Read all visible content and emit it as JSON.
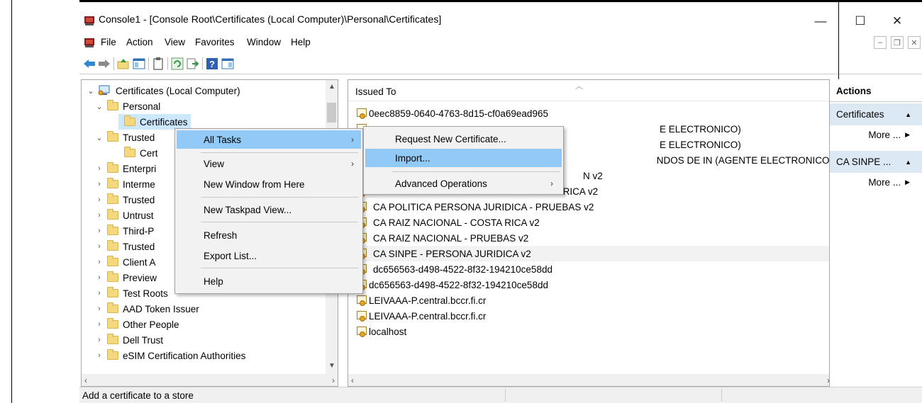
{
  "window": {
    "title": "Console1 - [Console Root\\Certificates (Local Computer)\\Personal\\Certificates]",
    "minimize_glyph": "—",
    "maximize_glyph": "☐",
    "close_glyph": "✕"
  },
  "menubar": {
    "items": [
      "File",
      "Action",
      "View",
      "Favorites",
      "Window",
      "Help"
    ]
  },
  "toolbar": {
    "icons": [
      "back-arrow-icon",
      "forward-arrow-icon",
      "up-folder-icon",
      "show-hide-console-tree-icon",
      "properties-icon",
      "refresh-icon",
      "export-list-icon",
      "help-icon",
      "show-hide-action-pane-icon"
    ]
  },
  "tree": {
    "items": [
      {
        "label": "Certificates (Local Computer)",
        "expanded": true,
        "icon": "computer-cert-icon"
      },
      {
        "label": "Personal",
        "expanded": true
      },
      {
        "label": "Certificates",
        "selected": true
      },
      {
        "label": "Trusted",
        "expanded": true
      },
      {
        "label": "Cert"
      },
      {
        "label": "Enterpri"
      },
      {
        "label": "Interme"
      },
      {
        "label": "Trusted"
      },
      {
        "label": "Untrust"
      },
      {
        "label": "Third-P"
      },
      {
        "label": "Trusted"
      },
      {
        "label": "Client A"
      },
      {
        "label": "Preview"
      },
      {
        "label": "Test Roots"
      },
      {
        "label": "AAD Token Issuer"
      },
      {
        "label": "Other People"
      },
      {
        "label": "Dell Trust"
      },
      {
        "label": "eSIM Certification Authorities"
      }
    ]
  },
  "list": {
    "column_header": "Issued To",
    "rows": [
      "0eec8859-0640-4763-8d15-cf0a69ead965",
      "E ELECTRONICO)",
      "E ELECTRONICO)",
      "NDOS DE IN (AGENTE ELECTRONICO)",
      "N v2",
      "A POLITICA PERSONA JURIDICA - COSTA RICA v2",
      "CA POLITICA PERSONA JURIDICA - PRUEBAS v2",
      "CA RAIZ NACIONAL - COSTA RICA v2",
      "CA RAIZ NACIONAL - PRUEBAS v2",
      "CA SINPE - PERSONA JURIDICA v2",
      "dc656563-d498-4522-8f32-194210ce58dd",
      "dc656563-d498-4522-8f32-194210ce58dd",
      "LEIVAAA-P.central.bccr.fi.cr",
      "LEIVAAA-P.central.bccr.fi.cr",
      "localhost"
    ],
    "partial_row_2": "BANCO CENTRAL DE COSTA RICA (AGENTE ELECTRONICO)"
  },
  "actions": {
    "header": "Actions",
    "groups": [
      {
        "title": "Certificates",
        "more": "More ..."
      },
      {
        "title": "CA SINPE ...",
        "more": "More ..."
      }
    ]
  },
  "context_menu": {
    "items": [
      {
        "label": "All Tasks",
        "submenu": true,
        "highlighted": true
      },
      {
        "label": "View",
        "submenu": true
      },
      {
        "label": "New Window from Here"
      },
      {
        "label": "New Taskpad View..."
      },
      {
        "label": "Refresh"
      },
      {
        "label": "Export List..."
      },
      {
        "label": "Help"
      }
    ]
  },
  "submenu": {
    "items": [
      {
        "label": "Request New Certificate..."
      },
      {
        "label": "Import...",
        "highlighted": true
      },
      {
        "label": "Advanced Operations",
        "submenu": true
      }
    ]
  },
  "statusbar": {
    "text": "Add a certificate to a store"
  },
  "colors": {
    "selection": "#cce8ff",
    "menu_highlight": "#91c9f7",
    "actions_group_bg": "#dde8f5",
    "folder": "#f5d77e"
  }
}
